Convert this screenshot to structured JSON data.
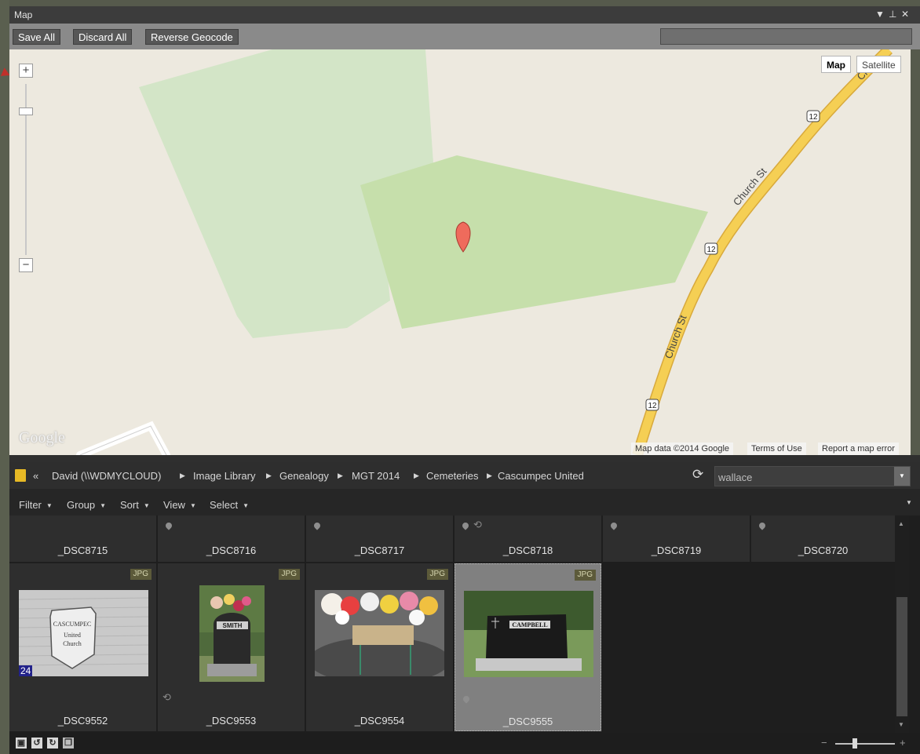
{
  "panel": {
    "title": "Map",
    "controls": {
      "menu": "▼",
      "pin": "⊥",
      "close": "✕"
    }
  },
  "toolbar": {
    "save_all": "Save All",
    "discard_all": "Discard All",
    "reverse_geocode": "Reverse Geocode"
  },
  "map": {
    "type_buttons": {
      "map": "Map",
      "satellite": "Satellite"
    },
    "zoom": {
      "plus": "+",
      "minus": "−"
    },
    "street_label_1": "Church St",
    "street_label_2": "Church St",
    "route_number": "12",
    "street_partial": "Ch",
    "logo": "Google",
    "attribution": {
      "data": "Map data ©2014 Google",
      "terms": "Terms of Use",
      "report": "Report a map error"
    },
    "colors": {
      "land": "#ede9df",
      "park": "#cfe3bf",
      "park_highlight": "#c5dea9",
      "road": "#f5cf54",
      "road_border": "#d8a93c",
      "marker": "#ef6b5c"
    }
  },
  "breadcrumb": {
    "back": "«",
    "items": [
      "David (\\\\WDMYCLOUD)",
      "Image Library",
      "Genealogy",
      "MGT 2014",
      "Cemeteries",
      "Cascumpec United"
    ],
    "separator": "▶"
  },
  "search": {
    "value": "wallace",
    "dropdown_icon": "▼"
  },
  "filterbar": {
    "items": [
      "Filter",
      "Group",
      "Sort",
      "View",
      "Select"
    ],
    "caret": "▼"
  },
  "grid": {
    "row1": [
      {
        "name": "_DSC8715",
        "pin": false,
        "sync": false
      },
      {
        "name": "_DSC8716",
        "pin": true,
        "sync": false
      },
      {
        "name": "_DSC8717",
        "pin": true,
        "sync": false
      },
      {
        "name": "_DSC8718",
        "pin": true,
        "sync": true
      },
      {
        "name": "_DSC8719",
        "pin": true,
        "sync": false
      },
      {
        "name": "_DSC8720",
        "pin": true,
        "sync": false
      }
    ],
    "row2": [
      {
        "name": "_DSC9552",
        "badge": "JPG",
        "count": "24"
      },
      {
        "name": "_DSC9553",
        "badge": "JPG"
      },
      {
        "name": "_DSC9554",
        "badge": "JPG"
      },
      {
        "name": "_DSC9555",
        "badge": "JPG",
        "selected": true
      }
    ],
    "thumb_text": {
      "sign_line1": "CASCUMPEC",
      "sign_line2": "United",
      "sign_line3": "Church",
      "smith": "SMITH",
      "campbell": "CAMPBELL"
    }
  },
  "statusbar": {
    "zoom_minus": "−",
    "zoom_plus": "+"
  }
}
